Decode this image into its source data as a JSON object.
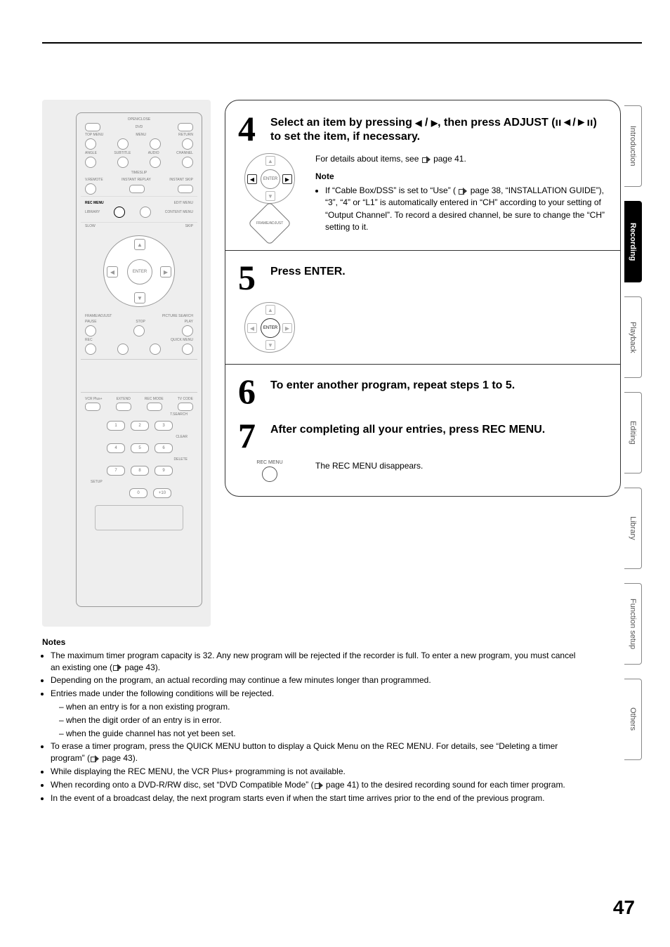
{
  "side_tabs": {
    "introduction": "Introduction",
    "recording": "Recording",
    "playback": "Playback",
    "editing": "Editing",
    "library": "Library",
    "function_setup": "Function setup",
    "others": "Others"
  },
  "remote": {
    "open_close": "OPEN/CLOSE",
    "dvd": "DVD",
    "top_menu": "TOP MENU",
    "menu": "MENU",
    "return": "RETURN",
    "angle": "ANGLE",
    "subtitle": "SUBTITLE",
    "audio": "AUDIO",
    "channel": "CHANNEL",
    "timeslip": "TIMESLIP",
    "vremote": "V.REMOTE",
    "instant_replay": "INSTANT REPLAY",
    "instant_skip": "INSTANT SKIP",
    "rec_menu": "REC MENU",
    "edit_menu": "EDIT MENU",
    "library": "LIBRARY",
    "content_menu": "CONTENT MENU",
    "slow": "SLOW",
    "skip": "SKIP",
    "enter": "ENTER",
    "frame_adjust": "FRAME/ADJUST",
    "picture_search": "PICTURE SEARCH",
    "pause": "PAUSE",
    "stop": "STOP",
    "play": "PLAY",
    "rec": "REC",
    "quick_menu": "QUICK MENU",
    "vcr_plus": "VCR Plus+",
    "extend": "EXTEND",
    "rec_mode": "REC MODE",
    "tv_code": "TV CODE",
    "t_search": "T.SEARCH",
    "clear": "CLEAR",
    "delete": "DELETE",
    "setup": "SETUP",
    "n0": "0",
    "n1": "1",
    "n2": "2",
    "n3": "3",
    "n4": "4",
    "n5": "5",
    "n6": "6",
    "n7": "7",
    "n8": "8",
    "n9": "9",
    "n10": "+10"
  },
  "step4": {
    "num": "4",
    "title_a": "Select an item by pressing ",
    "title_b": ", then press ADJUST (",
    "title_c": ") to set the item, if necessary.",
    "adjust_glyphs": "◄ / ►",
    "adjust_btn_glyphs": "ıı◄/►ıı",
    "detail": "For details about items, see ",
    "detail_page": " page 41.",
    "note_head": "Note",
    "note_body": "If “Cable Box/DSS” is set to “Use” ( ",
    "note_body2": " page 38, “INSTALLATION GUIDE”), “3”, “4” or “L1” is automatically entered in “CH” according to your setting of “Output Channel”. To record a desired channel, be sure to change the “CH” setting to it.",
    "illus_enter": "ENTER",
    "illus_frame": "FRAME/ADJUST"
  },
  "step5": {
    "num": "5",
    "title": "Press ENTER.",
    "illus_enter": "ENTER"
  },
  "step6": {
    "num": "6",
    "title": "To enter another program, repeat steps 1 to 5."
  },
  "step7": {
    "num": "7",
    "title": "After completing all your entries, press REC MENU.",
    "body": "The REC MENU disappears.",
    "illus_label": "REC MENU"
  },
  "notes": {
    "head": "Notes",
    "n1a": "The maximum timer program capacity is 32. Any new program will be rejected if the recorder is full. To enter a new program, you must cancel an existing one (",
    "n1b": " page 43).",
    "n2": "Depending on the program, an actual recording may continue a few minutes longer than programmed.",
    "n3": "Entries made under the following conditions will be rejected.",
    "n3a": "when an entry is for a non existing program.",
    "n3b": "when the digit order of an entry is in error.",
    "n3c": "when the guide channel has not yet been set.",
    "n4a": "To erase a timer program, press the QUICK MENU button to display a Quick Menu on the REC MENU. For details, see “Deleting a timer program” (",
    "n4b": " page 43).",
    "n5": "While displaying the REC MENU, the VCR Plus+ programming is not available.",
    "n6a": "When recording onto a DVD-R/RW disc, set “DVD Compatible Mode” (",
    "n6b": " page 41) to the desired recording sound for each timer program.",
    "n7": "In the event of a broadcast delay, the next program starts even if when the start time arrives prior to the end of the previous program."
  },
  "page_number": "47"
}
